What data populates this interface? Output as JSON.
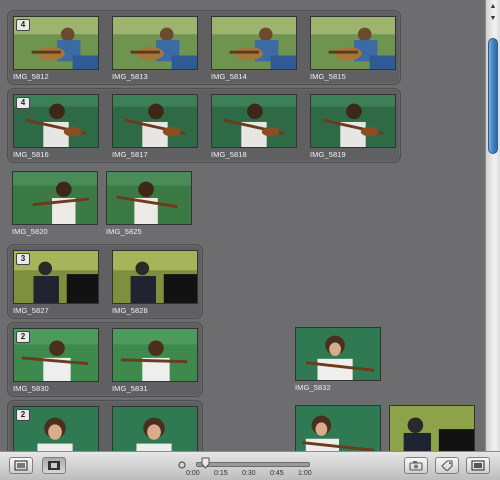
{
  "stacks": [
    {
      "badge": "4",
      "items": [
        "IMG_5812",
        "IMG_5813",
        "IMG_5814",
        "IMG_5815"
      ]
    },
    {
      "badge": "4",
      "items": [
        "IMG_5816",
        "IMG_5817",
        "IMG_5818",
        "IMG_5819"
      ]
    },
    {
      "badge": "3",
      "items": [
        "IMG_5827",
        "IMG_5828"
      ]
    },
    {
      "badge": "2",
      "items": [
        "IMG_5830",
        "IMG_5831"
      ]
    },
    {
      "badge": "2",
      "items": []
    }
  ],
  "loose_items": [
    "IMG_5820",
    "IMG_5825",
    "IMG_5832"
  ],
  "toolbar": {
    "ruler_labels": [
      "0:00",
      "0:15",
      "0:30",
      "0:45",
      "1:00"
    ],
    "left_buttons": [
      "clip-view-icon",
      "film-view-icon"
    ],
    "right_buttons": [
      "camera-icon",
      "tag-icon",
      "fullscreen-icon"
    ]
  },
  "colors": {
    "background": "#6d6d70",
    "stack_bg": "#606063",
    "scroll_thumb": "#3f7fc2"
  }
}
